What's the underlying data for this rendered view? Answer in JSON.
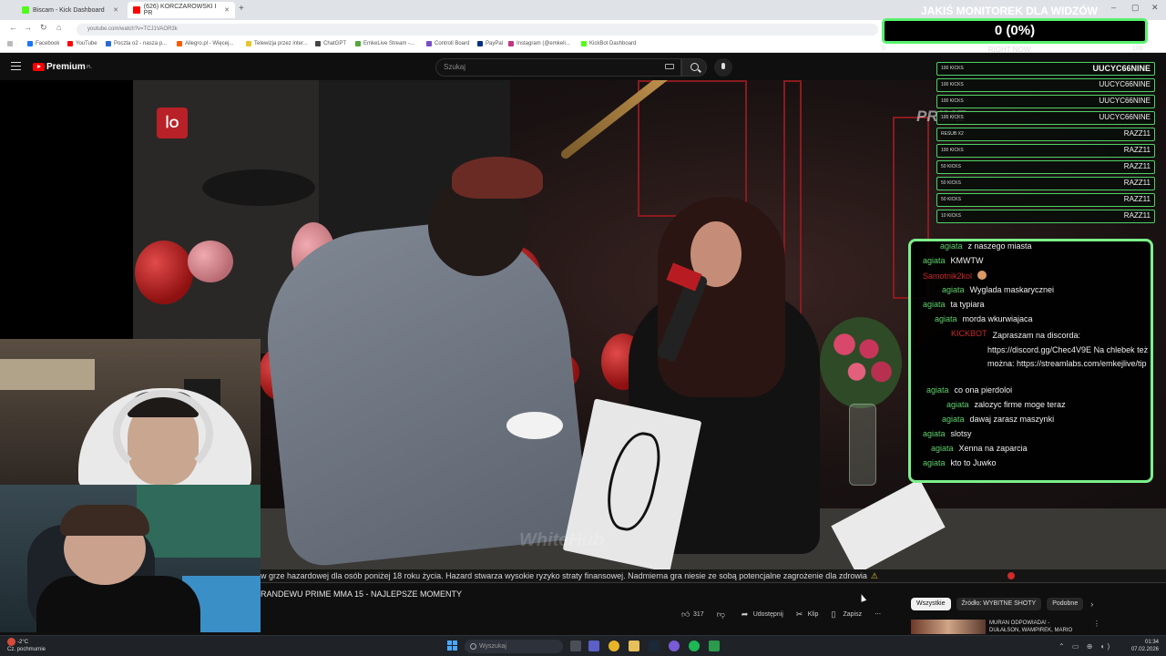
{
  "browser": {
    "tabs": [
      {
        "label": "Biscam - Kick Dashboard",
        "color": "#53fc18",
        "active": false
      },
      {
        "label": "(626) KORCZAROWSKI I PR",
        "color": "#ff0000",
        "active": true
      }
    ],
    "new_tab": "+",
    "window_controls": {
      "minimize": "–",
      "maximize": "▢",
      "close": "✕"
    },
    "url": "youtube.com/watch?v=TCJ1VAOR3k",
    "bookmarks": [
      {
        "label": "Facebook",
        "color": "#1877f2"
      },
      {
        "label": "YouTube",
        "color": "#ff0000"
      },
      {
        "label": "Poczta o2 - nasza p...",
        "color": "#2a6bd1"
      },
      {
        "label": "Allegro.pl - Więcej...",
        "color": "#ff5a00"
      },
      {
        "label": "Telewizja przez inter...",
        "color": "#e8c42a"
      },
      {
        "label": "ChatGPT",
        "color": "#444444"
      },
      {
        "label": "EmkeLive Stream -...",
        "color": "#53a63b"
      },
      {
        "label": "Controll Board",
        "color": "#7a4ec2"
      },
      {
        "label": "PayPal",
        "color": "#003087"
      },
      {
        "label": "Instagram (@emkeli...",
        "color": "#c13584"
      },
      {
        "label": "KickBot Dashboard",
        "color": "#53fc18"
      }
    ]
  },
  "youtube": {
    "logo": "Premium",
    "logo_region": "PL",
    "search_placeholder": "Szukaj",
    "video_title": "RANDEWU PRIME MMA 15 - NAJLEPSZE MOMENTY",
    "disclaimer": "w grze hazardowej dla osób poniżej 18 roku życia. Hazard stwarza wysokie ryzyko straty finansowej. Nadmierna gra niesie ze sobą potencjalne zagrożenie dla zdrowia",
    "disclaimer_icon": "⚠",
    "prime_badge": "ꟾO",
    "prime_logo": "PRIME",
    "watermark": "WhiteHub",
    "actions": {
      "likes": "317",
      "share": "Udostępnij",
      "clip": "Klip",
      "save": "Zapisz",
      "more": "⋯"
    },
    "chips": [
      "Wszystkie",
      "Źródło: WYBITNE SHOTY",
      "Podobne"
    ],
    "recommendation": {
      "title": "MURAN ODPOWIADA! -",
      "subtitle": "DUŁAŁSON, WAMPIREK, MARIO"
    }
  },
  "overlay": {
    "monitor_title": "JAKIŚ MONITOREK DLA WIDZÓW",
    "monitor_value": "0 (0%)",
    "monitor_progress": 0,
    "monitor_min": "0",
    "monitor_max": "100",
    "monitor_sub": "RIGHT NOW",
    "accent_green": "#58f26e"
  },
  "donations": [
    {
      "amount": "100 KICKS",
      "name": "UUCYC66NINE"
    },
    {
      "amount": "100 KICKS",
      "name": "UUCYC66NINE"
    },
    {
      "amount": "100 KICKS",
      "name": "UUCYC66NINE"
    },
    {
      "amount": "100 KICKS",
      "name": "UUCYC66NINE"
    },
    {
      "amount": "RESUB X2",
      "name": "RAZZ11"
    },
    {
      "amount": "100 KICKS",
      "name": "RAZZ11"
    },
    {
      "amount": "50 KICKS",
      "name": "RAZZ11"
    },
    {
      "amount": "50 KICKS",
      "name": "RAZZ11"
    },
    {
      "amount": "50 KICKS",
      "name": "RAZZ11"
    },
    {
      "amount": "10 KICKS",
      "name": "RAZZ11"
    }
  ],
  "chat": [
    {
      "user": "agiata",
      "text": "z naszego miasta"
    },
    {
      "user": "agiata",
      "text": "KMWTW"
    },
    {
      "user": "Samotnik2kol",
      "text": ""
    },
    {
      "user": "agiata",
      "text": "Wyglada maskarycznei"
    },
    {
      "user": "agiata",
      "text": "ta typiara"
    },
    {
      "user": "agiata",
      "text": "morda wkurwiajaca"
    },
    {
      "user": "KICKBOT",
      "text": "Zapraszam na discorda: https://discord.gg/Chec4V9E Na chlebek też można: https://streamlabs.com/emkejlive/tip"
    },
    {
      "user": "agiata",
      "text": "co ona pierdoloi"
    },
    {
      "user": "agiata",
      "text": "zalozyc firme moge teraz"
    },
    {
      "user": "agiata",
      "text": "dawaj zarasz maszynki"
    },
    {
      "user": "agiata",
      "text": "slotsy"
    },
    {
      "user": "agiata",
      "text": "Xenna na zaparcia"
    },
    {
      "user": "agiata",
      "text": "kto to Juwko"
    }
  ],
  "taskbar": {
    "temp": "-2°C",
    "weather": "Cz. pochmurnie",
    "search": "Wyszukaj",
    "time": "01:34",
    "date": "07.02.2026",
    "tray_icons": "⌃ ▭ ⊕ ◖)"
  }
}
